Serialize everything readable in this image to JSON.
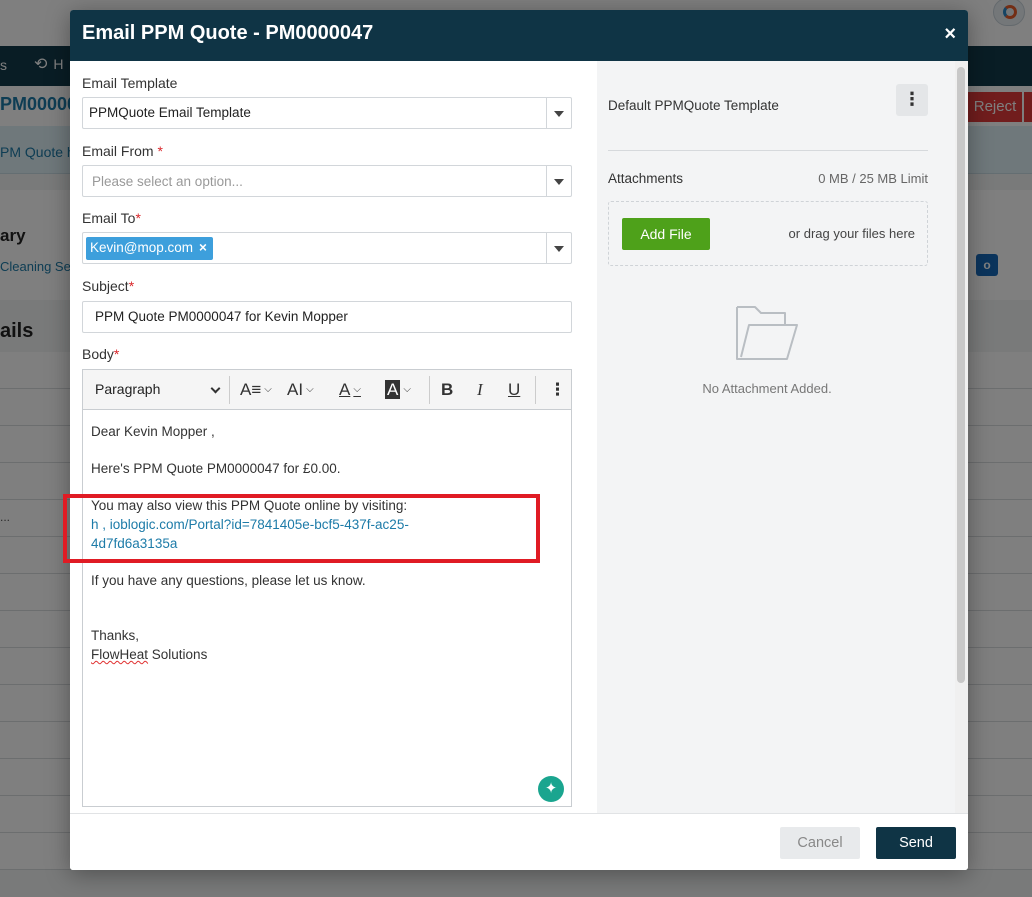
{
  "background": {
    "nav_item_partial": "s",
    "nav_history_partial": "H",
    "record_ref_partial": "PM00000",
    "reject_label": "Reject",
    "sub_header_partial": "PM Quote h",
    "summary_partial": "ary",
    "cleaning_partial": "Cleaning Se",
    "details_partial": "ails",
    "row_ellipsis": "..."
  },
  "modal": {
    "title": "Email PPM Quote - PM0000047",
    "close_glyph": "×"
  },
  "form": {
    "template_label": "Email Template",
    "template_value": "PPMQuote Email Template",
    "from_label": "Email From",
    "from_placeholder": "Please select an option...",
    "to_label": "Email To",
    "to_tag": "Kevin@mop.com",
    "to_tag_remove": "×",
    "subject_label": "Subject",
    "subject_value": "PPM Quote PM0000047 for Kevin  Mopper",
    "body_label": "Body",
    "required_mark": "*"
  },
  "toolbar": {
    "paragraph_label": "Paragraph",
    "font_size_glyph": "A≡",
    "font_case_glyph": "AI",
    "font_color_glyph": "A",
    "highlight_glyph": "A",
    "bold_glyph": "B",
    "italic_glyph": "I",
    "underline_glyph": "U",
    "more_glyph": "⋮"
  },
  "body": {
    "greeting": "Dear Kevin Mopper ,",
    "line1": "Here's PPM Quote PM0000047 for £0.00.",
    "line2": "You may also view this PPM Quote online by visiting:",
    "link_line1": "h      ,        ioblogic.com/Portal?id=7841405e-bcf5-437f-ac25-",
    "link_line2": "4d7fd6a3135a",
    "line3": "If you have any questions, please let us know.",
    "sign_off": "Thanks,",
    "company_part1": "FlowHeat",
    "company_part2": " Solutions",
    "ai_glyph": "✦"
  },
  "attachments_panel": {
    "template_name": "Default PPMQuote Template",
    "kebab_glyph": "⋮",
    "attachments_label": "Attachments",
    "limit_text": "0 MB / 25 MB Limit",
    "add_file_label": "Add File",
    "drag_text": "or drag your files here",
    "empty_text": "No Attachment Added."
  },
  "footer": {
    "cancel_label": "Cancel",
    "send_label": "Send"
  }
}
